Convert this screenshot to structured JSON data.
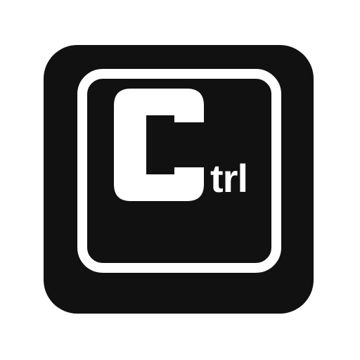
{
  "key": {
    "letter": "C",
    "suffix": "trl"
  },
  "icon": {
    "name": "ctrl-key-icon"
  },
  "colors": {
    "key_fill": "#111111",
    "glyph": "#ffffff",
    "background": "#ffffff"
  }
}
